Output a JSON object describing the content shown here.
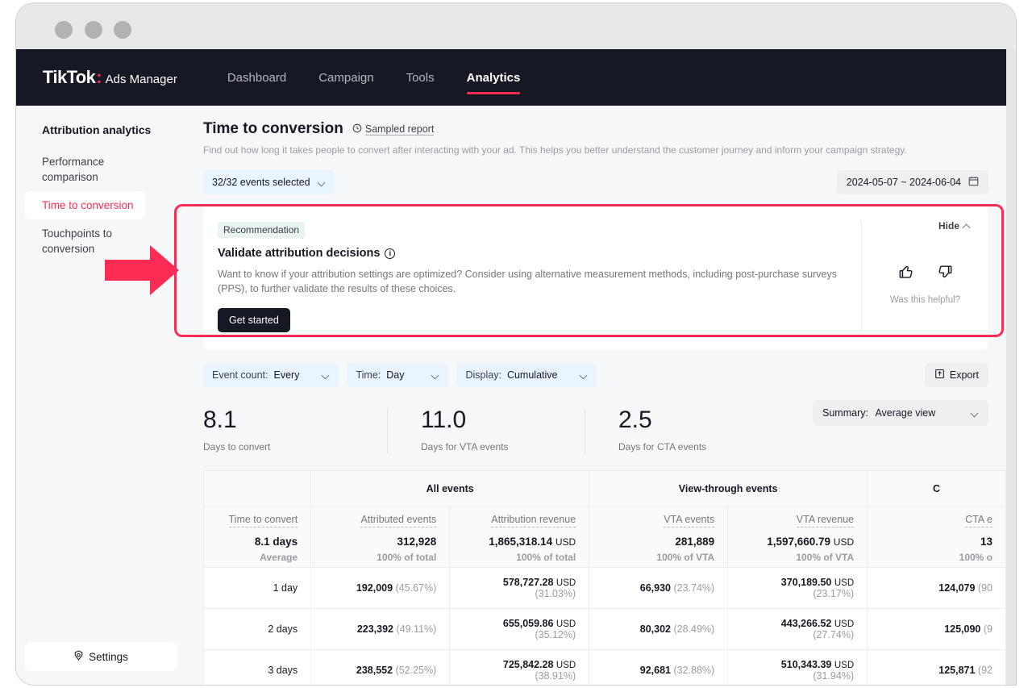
{
  "window": {
    "dots": [
      "close",
      "minimize",
      "maximize"
    ]
  },
  "topnav": {
    "brand_tik": "TikTok",
    "brand_colon": ":",
    "brand_suffix": "Ads Manager",
    "links": [
      {
        "label": "Dashboard",
        "active": false
      },
      {
        "label": "Campaign",
        "active": false
      },
      {
        "label": "Tools",
        "active": false
      },
      {
        "label": "Analytics",
        "active": true
      }
    ]
  },
  "sidebar": {
    "title": "Attribution analytics",
    "items": [
      {
        "label": "Performance comparison",
        "active": false
      },
      {
        "label": "Time to conversion",
        "active": true
      },
      {
        "label": "Touchpoints to conversion",
        "active": false
      }
    ],
    "settings_label": "Settings"
  },
  "page": {
    "title": "Time to conversion",
    "sampled_label": "Sampled report",
    "description": "Find out how long it takes people to convert after interacting with your ad. This helps you better understand the customer journey and inform your campaign strategy."
  },
  "filters": {
    "events_selected": "32/32 events selected",
    "date_range": "2024-05-07 ~ 2024-06-04"
  },
  "recommendation": {
    "badge": "Recommendation",
    "title": "Validate attribution decisions",
    "body": "Want to know if your attribution settings are optimized? Consider using alternative measurement methods, including post-purchase surveys (PPS), to further validate the results of these choices.",
    "cta": "Get started",
    "hide_label": "Hide",
    "feedback_label": "Was this helpful?"
  },
  "controls": {
    "event_count": {
      "label": "Event count:",
      "value": "Every"
    },
    "time": {
      "label": "Time:",
      "value": "Day"
    },
    "display": {
      "label": "Display:",
      "value": "Cumulative"
    },
    "export_label": "Export",
    "summary": {
      "label": "Summary:",
      "value": "Average view"
    }
  },
  "metrics": [
    {
      "value": "8.1",
      "caption": "Days to convert"
    },
    {
      "value": "11.0",
      "caption": "Days for VTA events"
    },
    {
      "value": "2.5",
      "caption": "Days for CTA events"
    }
  ],
  "table": {
    "groups": [
      {
        "label": "",
        "span": 1
      },
      {
        "label": "All events",
        "span": 2
      },
      {
        "label": "View-through events",
        "span": 2
      },
      {
        "label": "C",
        "span": 1
      }
    ],
    "columns": [
      {
        "name": "Time to convert",
        "summary_value": "8.1 days",
        "summary_unit": "",
        "summary_sub": "Average"
      },
      {
        "name": "Attributed events",
        "summary_value": "312,928",
        "summary_unit": "",
        "summary_sub": "100% of total"
      },
      {
        "name": "Attribution revenue",
        "summary_value": "1,865,318.14",
        "summary_unit": "USD",
        "summary_sub": "100% of total"
      },
      {
        "name": "VTA events",
        "summary_value": "281,889",
        "summary_unit": "",
        "summary_sub": "100% of VTA"
      },
      {
        "name": "VTA revenue",
        "summary_value": "1,597,660.79",
        "summary_unit": "USD",
        "summary_sub": "100% of VTA"
      },
      {
        "name": "CTA e",
        "summary_value": "13",
        "summary_unit": "",
        "summary_sub": "100% o"
      }
    ],
    "rows": [
      {
        "label": "1 day",
        "cells": [
          {
            "main": "192,009",
            "unit": "",
            "pct": "(45.67%)"
          },
          {
            "main": "578,727.28",
            "unit": "USD",
            "pct": "(31.03%)"
          },
          {
            "main": "66,930",
            "unit": "",
            "pct": "(23.74%)"
          },
          {
            "main": "370,189.50",
            "unit": "USD",
            "pct": "(23.17%)"
          },
          {
            "main": "124,079",
            "unit": "",
            "pct": "(90"
          }
        ]
      },
      {
        "label": "2 days",
        "cells": [
          {
            "main": "223,392",
            "unit": "",
            "pct": "(49.11%)"
          },
          {
            "main": "655,059.86",
            "unit": "USD",
            "pct": "(35.12%)"
          },
          {
            "main": "80,302",
            "unit": "",
            "pct": "(28.49%)"
          },
          {
            "main": "443,266.52",
            "unit": "USD",
            "pct": "(27.74%)"
          },
          {
            "main": "125,090",
            "unit": "",
            "pct": "(9"
          }
        ]
      },
      {
        "label": "3 days",
        "cells": [
          {
            "main": "238,552",
            "unit": "",
            "pct": "(52.25%)"
          },
          {
            "main": "725,842.28",
            "unit": "USD",
            "pct": "(38.91%)"
          },
          {
            "main": "92,681",
            "unit": "",
            "pct": "(32.88%)"
          },
          {
            "main": "510,343.39",
            "unit": "USD",
            "pct": "(31.94%)"
          },
          {
            "main": "125,871",
            "unit": "",
            "pct": "(92"
          }
        ]
      }
    ]
  },
  "colors": {
    "accent": "#fe2c55",
    "nav_bg": "#161823",
    "page_bg": "#f6f7f8",
    "pill_bg": "#eaf4fe",
    "badge_bg": "#e9f4f2"
  }
}
